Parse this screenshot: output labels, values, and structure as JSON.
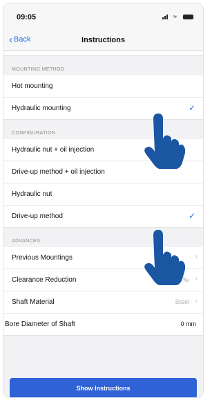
{
  "status_bar": {
    "time": "09:05"
  },
  "nav": {
    "back_label": "Back",
    "title": "Instructions"
  },
  "sections": {
    "mounting": {
      "header": "MOUNTING METHOD",
      "items": [
        {
          "label": "Hot mounting",
          "selected": false
        },
        {
          "label": "Hydraulic mounting",
          "selected": true
        }
      ]
    },
    "configuration": {
      "header": "CONFIGURATION",
      "items": [
        {
          "label": "Hydraulic nut + oil injection",
          "selected": false
        },
        {
          "label": "Drive-up method + oil injection",
          "selected": false
        },
        {
          "label": "Hydraulic nut",
          "selected": false
        },
        {
          "label": "Drive-up method",
          "selected": true
        }
      ]
    },
    "advanced": {
      "header": "ADVANCED",
      "items": [
        {
          "label": "Previous Mountings",
          "value": ""
        },
        {
          "label": "Clearance Reduction",
          "value": "0.45 ‰"
        },
        {
          "label": "Shaft Material",
          "value": "Steel"
        },
        {
          "label": "Bore Diameter of Shaft",
          "value": "0 mm"
        }
      ]
    }
  },
  "check_glyph": "✓",
  "chevron_glyph": "›",
  "show_button_label": "Show Instructions",
  "colors": {
    "accent": "#2f63d5",
    "hand": "#1b56a3"
  }
}
